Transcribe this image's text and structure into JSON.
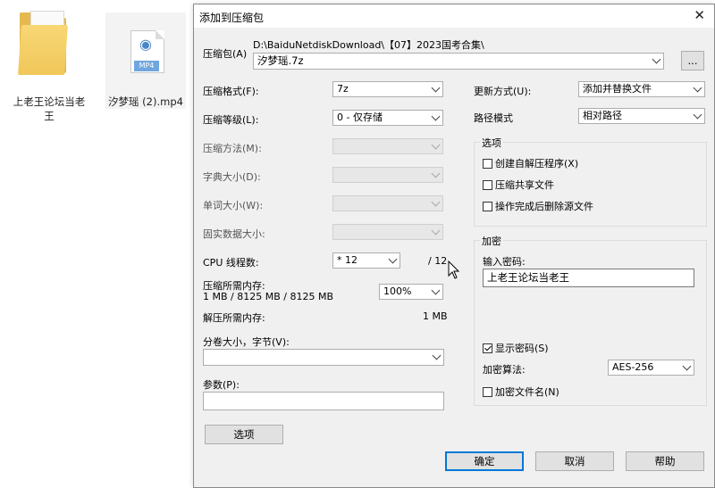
{
  "desktop": {
    "folder_label": "上老王论坛当老王",
    "file_label": "汐梦瑶 (2).mp4",
    "file_badge": "MP4"
  },
  "dialog": {
    "title": "添加到压缩包",
    "archive_label": "压缩包(A)",
    "archive_path": "D:\\BaiduNetdiskDownload\\【07】2023国考合集\\",
    "archive_name": "汐梦瑶.7z",
    "browse_label": "...",
    "format_label": "压缩格式(F):",
    "format_value": "7z",
    "level_label": "压缩等级(L):",
    "level_value": "0 - 仅存储",
    "method_label": "压缩方法(M):",
    "dict_label": "字典大小(D):",
    "word_label": "单词大小(W):",
    "solid_label": "固实数据大小:",
    "cpu_label": "CPU 线程数:",
    "cpu_value": "* 12",
    "cpu_total": "/ 12",
    "mem_comp_label": "压缩所需内存:",
    "mem_comp_value": "1 MB / 8125 MB / 8125 MB",
    "mem_percent": "100%",
    "mem_decomp_label": "解压所需内存:",
    "mem_decomp_value": "1 MB",
    "split_label": "分卷大小，字节(V):",
    "split_value": "",
    "params_label": "参数(P):",
    "params_value": "",
    "options_button": "选项",
    "update_label": "更新方式(U):",
    "update_value": "添加并替换文件",
    "path_label": "路径模式",
    "path_value": "相对路径",
    "options_group": "选项",
    "opt_sfx": "创建自解压程序(X)",
    "opt_shared": "压缩共享文件",
    "opt_delete": "操作完成后删除源文件",
    "encrypt_group": "加密",
    "password_label": "输入密码:",
    "password_value": "上老王论坛当老王",
    "show_password": "显示密码(S)",
    "encrypt_method_label": "加密算法:",
    "encrypt_method_value": "AES-256",
    "encrypt_names": "加密文件名(N)",
    "ok": "确定",
    "cancel": "取消",
    "help": "帮助"
  }
}
